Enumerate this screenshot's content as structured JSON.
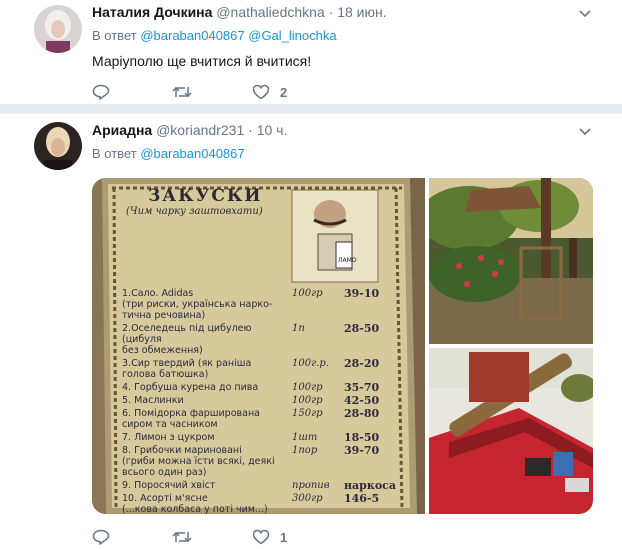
{
  "tweets": [
    {
      "name": "Наталия Дочкина",
      "handle": "@nathaliedchkna",
      "time": "18 июн.",
      "reply_prefix": "В ответ",
      "reply_to": [
        "@baraban040867",
        "@Gal_linochka"
      ],
      "text": "Маріуполю ще вчитися й вчитися!",
      "likes": "2"
    },
    {
      "name": "Ариадна",
      "handle": "@koriandr231",
      "time": "10 ч.",
      "reply_prefix": "В ответ",
      "reply_to": [
        "@baraban040867"
      ],
      "likes": "1"
    }
  ],
  "separator": "·",
  "menu": {
    "title": "ЗАКУСКИ",
    "subtitle": "(Чим чарку заштовхати)",
    "items": [
      {
        "line1": "1.Сало. Adidas",
        "line2": "(три риски, українська нарко-",
        "line3": "тична речовина)",
        "qty": "100гр",
        "price": "39-10"
      },
      {
        "line1": "2.Оселедець під цибулею (цибуля",
        "line2": "без обмеження)",
        "qty": "1п",
        "price": "28-50"
      },
      {
        "line1": "3.Сир твердий (як раніша",
        "line2": "голова батюшка)",
        "qty": "100г.р.",
        "price": "28-20"
      },
      {
        "line1": "4. Горбуша курена до пива",
        "qty": "100гр",
        "price": "35-70"
      },
      {
        "line1": "5. Маслинки",
        "qty": "100гр",
        "price": "42-50"
      },
      {
        "line1": "6. Помідорка фарширована",
        "line2": "сиром та часником",
        "qty": "150гр",
        "price": "28-80"
      },
      {
        "line1": "7. Лимон з цукром",
        "qty": "1шт",
        "price": "18-50"
      },
      {
        "line1": "8. Грибочки мариновані",
        "line2": "(гриби можна їсти всякі, деякі",
        "line3": "всього один раз)",
        "qty": "1пор",
        "price": "39-70"
      },
      {
        "line1": "9. Поросячий хвіст",
        "qty": "пропив",
        "price": "наркоса"
      },
      {
        "line1": "10. Асорті м'ясне",
        "line2": "(...кова колбаса у поті чим...)",
        "qty": "300гр",
        "price": "146-5"
      }
    ]
  },
  "colors": {
    "link": "#1b95e0",
    "gray": "#657786",
    "divider": "#e6ecf0"
  }
}
